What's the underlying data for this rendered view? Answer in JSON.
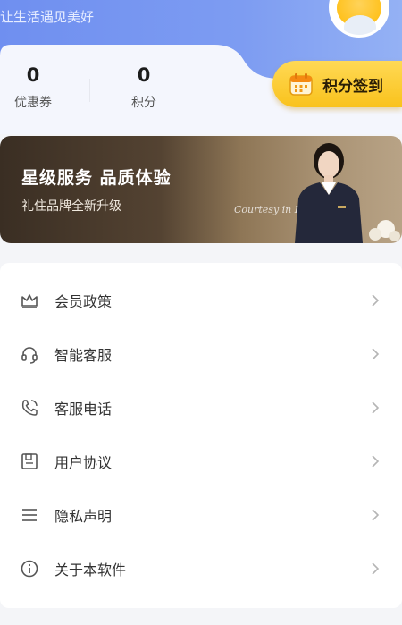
{
  "header": {
    "tagline": "让生活遇见美好"
  },
  "stats": [
    {
      "value": "0",
      "label": "优惠券"
    },
    {
      "value": "0",
      "label": "积分"
    }
  ],
  "signin": {
    "label": "积分签到",
    "icon": "calendar-icon"
  },
  "banner": {
    "title": "星级服务 品质体验",
    "subtitle": "礼住品牌全新升级",
    "script_text": "Courtesy in Life"
  },
  "menu": [
    {
      "label": "会员政策",
      "icon": "crown-icon"
    },
    {
      "label": "智能客服",
      "icon": "headset-icon"
    },
    {
      "label": "客服电话",
      "icon": "phone-icon"
    },
    {
      "label": "用户协议",
      "icon": "document-icon"
    },
    {
      "label": "隐私声明",
      "icon": "list-icon"
    },
    {
      "label": "关于本软件",
      "icon": "info-icon"
    }
  ],
  "colors": {
    "header": "#7d9cf2",
    "signin_button": "#f9c21c",
    "page_bg": "#f4f5f8"
  }
}
